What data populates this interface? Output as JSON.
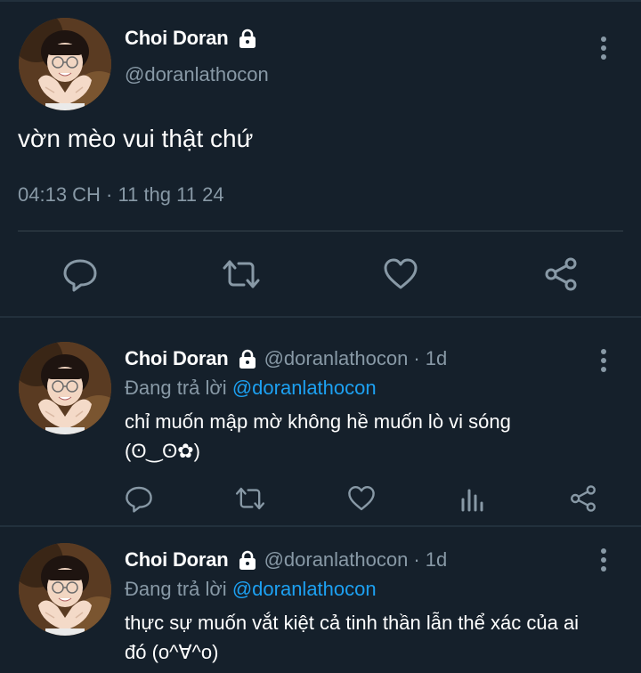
{
  "main_tweet": {
    "author_name": "Choi Doran",
    "author_handle": "@doranlathocon",
    "text": "vờn mèo vui thật chứ",
    "timestamp": "04:13 CH · 11 thg 11 24",
    "protected_icon": "lock-icon",
    "actions": [
      "reply-icon",
      "retweet-icon",
      "like-icon",
      "share-icon"
    ]
  },
  "replies": [
    {
      "author_name": "Choi Doran",
      "author_handle": "@doranlathocon",
      "time_ago": "· 1d",
      "replying_prefix": "Đang trả lời",
      "replying_to": "@doranlathocon",
      "line1": "chỉ muốn mập mờ không hề muốn lò vi sóng",
      "line2": "(ʘ‿ʘ✿)",
      "actions": [
        "reply-icon",
        "retweet-icon",
        "like-icon",
        "analytics-icon",
        "share-icon"
      ]
    },
    {
      "author_name": "Choi Doran",
      "author_handle": "@doranlathocon",
      "time_ago": "· 1d",
      "replying_prefix": "Đang trả lời",
      "replying_to": "@doranlathocon",
      "line1": "thực sự muốn vắt kiệt cả tinh thần lẫn thể xác của ai",
      "line2": "đó (o^∀^o)"
    }
  ],
  "colors": {
    "background": "#15202b",
    "secondary_text": "#8899a6",
    "link": "#1da1f2",
    "divider": "#38444d"
  }
}
